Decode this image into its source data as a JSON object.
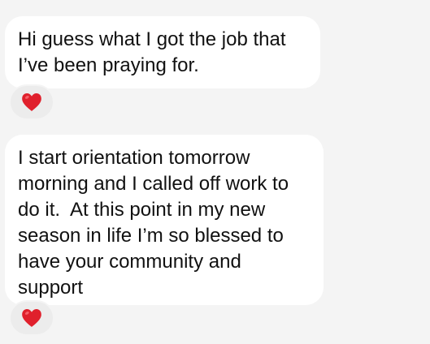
{
  "messages": [
    {
      "text": "Hi guess what I got the job that\nI’ve been praying for.",
      "reaction": "red-heart-icon"
    },
    {
      "text": "I start orientation tomorrow\nmorning and I called off work to\ndo it.  At this point in my new\nseason in life I’m so blessed to\nhave your community and\nsupport",
      "reaction": "red-heart-icon"
    }
  ],
  "colors": {
    "background": "#f4f4f4",
    "bubble": "#ffffff",
    "reaction_pill": "#ececec",
    "heart": "#e0202c",
    "text": "#111111"
  }
}
